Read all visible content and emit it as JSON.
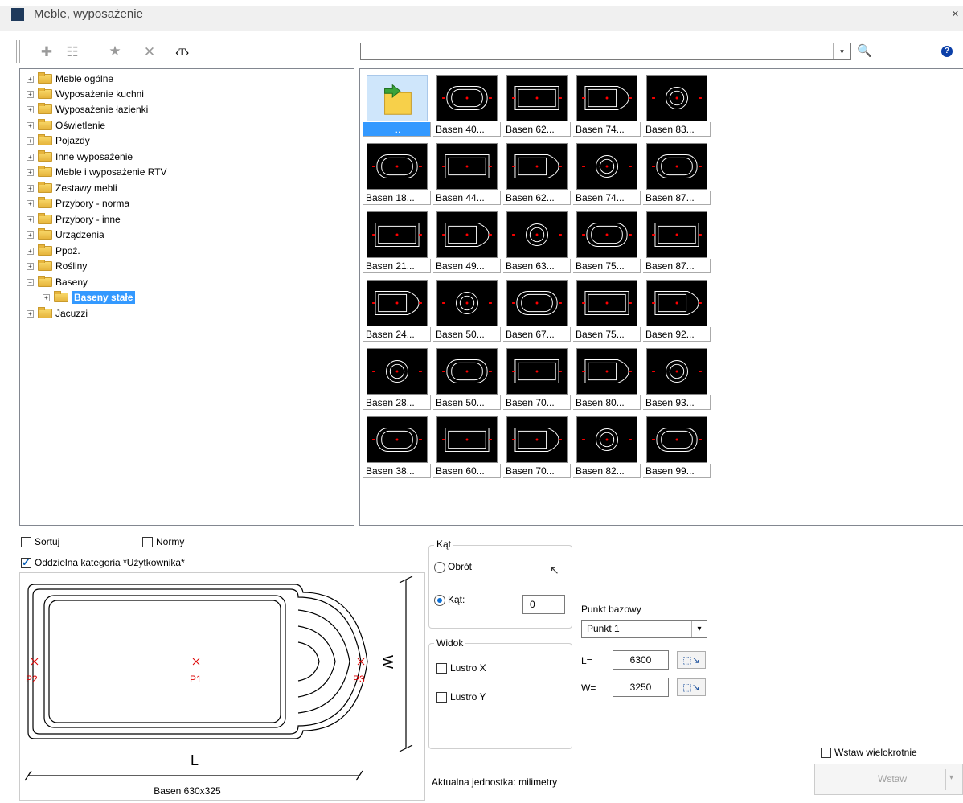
{
  "window": {
    "title": "Meble, wyposażenie",
    "close": "×"
  },
  "toolbar": {
    "plus": "✚",
    "properties": "☷",
    "favorite": "★",
    "delete": "✕",
    "text": "‹T›",
    "search_dropdown": "▾",
    "search_icon": "🔍",
    "help": "?"
  },
  "tree": {
    "items": [
      {
        "label": "Meble ogólne"
      },
      {
        "label": "Wyposażenie kuchni"
      },
      {
        "label": "Wyposażenie łazienki"
      },
      {
        "label": "Oświetlenie"
      },
      {
        "label": "Pojazdy"
      },
      {
        "label": "Inne wyposażenie"
      },
      {
        "label": "Meble i wyposażenie RTV"
      },
      {
        "label": "Zestawy mebli"
      },
      {
        "label": "Przybory - norma"
      },
      {
        "label": "Przybory - inne"
      },
      {
        "label": "Urządzenia"
      },
      {
        "label": "Ppoż."
      },
      {
        "label": "Rośliny"
      },
      {
        "label": "Baseny"
      },
      {
        "label": "Baseny stałe"
      },
      {
        "label": "Jacuzzi"
      }
    ],
    "expand_plus": "+",
    "expand_minus": "−"
  },
  "grid": {
    "up_label": "..",
    "items": [
      "Basen 40...",
      "Basen 62...",
      "Basen 74...",
      "Basen 83...",
      "Basen 18...",
      "Basen 44...",
      "Basen 62...",
      "Basen 74...",
      "Basen 87...",
      "Basen 21...",
      "Basen 49...",
      "Basen 63...",
      "Basen 75...",
      "Basen 87...",
      "Basen 24...",
      "Basen 50...",
      "Basen 67...",
      "Basen 75...",
      "Basen 92...",
      "Basen 28...",
      "Basen 50...",
      "Basen 70...",
      "Basen 80...",
      "Basen 93...",
      "Basen 38...",
      "Basen 60...",
      "Basen 70...",
      "Basen 82...",
      "Basen 99..."
    ]
  },
  "options": {
    "sort": "Sortuj",
    "norms": "Normy",
    "user_category": "Oddzielna kategoria *Użytkownika*"
  },
  "preview": {
    "caption": "Basen 630x325",
    "dim_l": "L",
    "dim_w": "W",
    "p1": "P1",
    "p2": "P2",
    "p3": "P3"
  },
  "angle": {
    "legend": "Kąt",
    "rotation": "Obrót",
    "angle_label": "Kąt:",
    "angle_value": "0"
  },
  "view": {
    "legend": "Widok",
    "mirror_x": "Lustro X",
    "mirror_y": "Lustro Y"
  },
  "base_point": {
    "label": "Punkt bazowy",
    "value": "Punkt 1",
    "dropdown": "▾",
    "l_label": "L=",
    "l_value": "6300",
    "w_label": "W=",
    "w_value": "3250"
  },
  "status": {
    "units": "Aktualna jednostka: milimetry"
  },
  "insert": {
    "multiple": "Wstaw wielokrotnie",
    "button": "Wstaw",
    "arrow": "▾"
  }
}
